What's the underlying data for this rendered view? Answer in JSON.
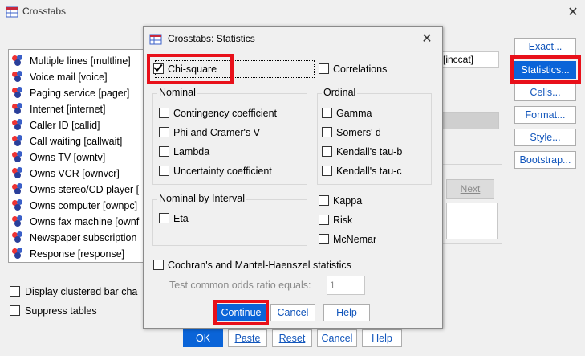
{
  "window": {
    "title": "Crosstabs",
    "close_glyph": "✕",
    "icon": "crosstabs-app-icon"
  },
  "variables": [
    "Multiple lines [multline]",
    "Voice mail [voice]",
    "Paging service [pager]",
    "Internet [internet]",
    "Caller ID [callid]",
    "Call waiting [callwait]",
    "Owns TV [owntv]",
    "Owns VCR [ownvcr]",
    "Owns stereo/CD player [",
    "Owns computer [ownpc]",
    "Owns fax machine [ownf",
    "Newspaper subscription",
    "Response [response]"
  ],
  "background": {
    "field_text": "[inccat]",
    "next_label": "Next",
    "display_clustered": "Display clustered bar cha",
    "suppress_tables": "Suppress tables"
  },
  "side_buttons": {
    "exact": "Exact...",
    "statistics": "Statistics...",
    "cells": "Cells...",
    "format": "Format...",
    "style": "Style...",
    "bootstrap": "Bootstrap..."
  },
  "bottom_buttons": {
    "ok": "OK",
    "paste": "Paste",
    "reset": "Reset",
    "cancel": "Cancel",
    "help": "Help"
  },
  "dialog": {
    "title": "Crosstabs: Statistics",
    "close_glyph": "✕",
    "chi_square": {
      "label": "Chi-square",
      "checked": true
    },
    "correlations": "Correlations",
    "nominal": {
      "title": "Nominal",
      "items": [
        "Contingency coefficient",
        "Phi and Cramer's V",
        "Lambda",
        "Uncertainty coefficient"
      ]
    },
    "ordinal": {
      "title": "Ordinal",
      "items": [
        "Gamma",
        "Somers' d",
        "Kendall's tau-b",
        "Kendall's tau-c"
      ]
    },
    "nominal_by_interval": {
      "title": "Nominal by Interval",
      "items": [
        "Eta"
      ]
    },
    "right_items": [
      "Kappa",
      "Risk",
      "McNemar"
    ],
    "cochrans": "Cochran's and Mantel-Haenszel statistics",
    "odds_label": "Test common odds ratio equals:",
    "odds_value": "1",
    "buttons": {
      "continue": "Continue",
      "cancel": "Cancel",
      "help": "Help"
    }
  },
  "colors": {
    "highlight": "#e8101a",
    "accent": "#0a64d8"
  }
}
